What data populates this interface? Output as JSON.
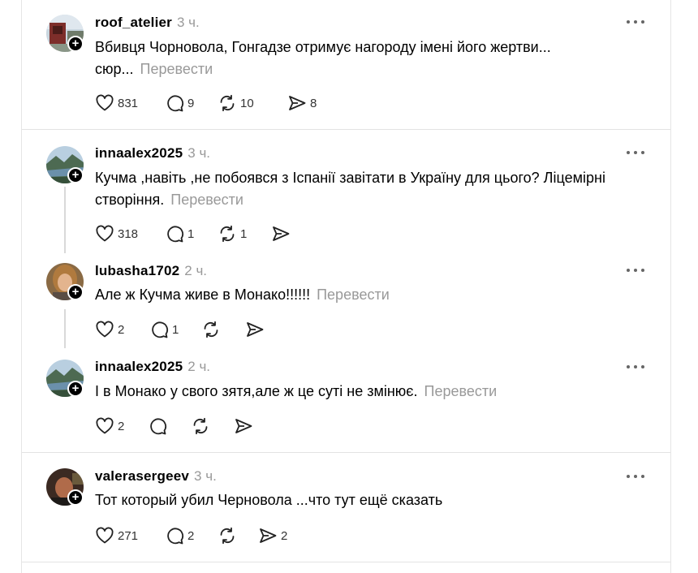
{
  "translate_label": "Перевести",
  "posts": [
    {
      "username": "roof_atelier",
      "time": "3 ч.",
      "text": "Вбивця Чорновола, Гонгадзе отримує нагороду імені його жертви... сюр...",
      "likes": "831",
      "replies": "9",
      "reposts": "10",
      "shares": "8"
    },
    {
      "username": "innaalex2025",
      "time": "3 ч.",
      "text": "Кучма ,навіть ,не побоявся з Іспанії завітати в Україну для цього? Ліцемірні створіння.",
      "likes": "318",
      "replies": "1",
      "reposts": "1",
      "shares": ""
    },
    {
      "username": "lubasha1702",
      "time": "2 ч.",
      "text": "Але ж Кучма живе в Монако!!!!!!",
      "likes": "2",
      "replies": "1",
      "reposts": "",
      "shares": ""
    },
    {
      "username": "innaalex2025",
      "time": "2 ч.",
      "text": "І в Монако у свого зятя,але ж це суті не змінює.",
      "likes": "2",
      "replies": "",
      "reposts": "",
      "shares": ""
    },
    {
      "username": "valerasergeev",
      "time": "3 ч.",
      "text": "Тот который убил Черновола ...что тут ещё сказать",
      "likes": "271",
      "replies": "2",
      "reposts": "",
      "shares": "2"
    }
  ]
}
